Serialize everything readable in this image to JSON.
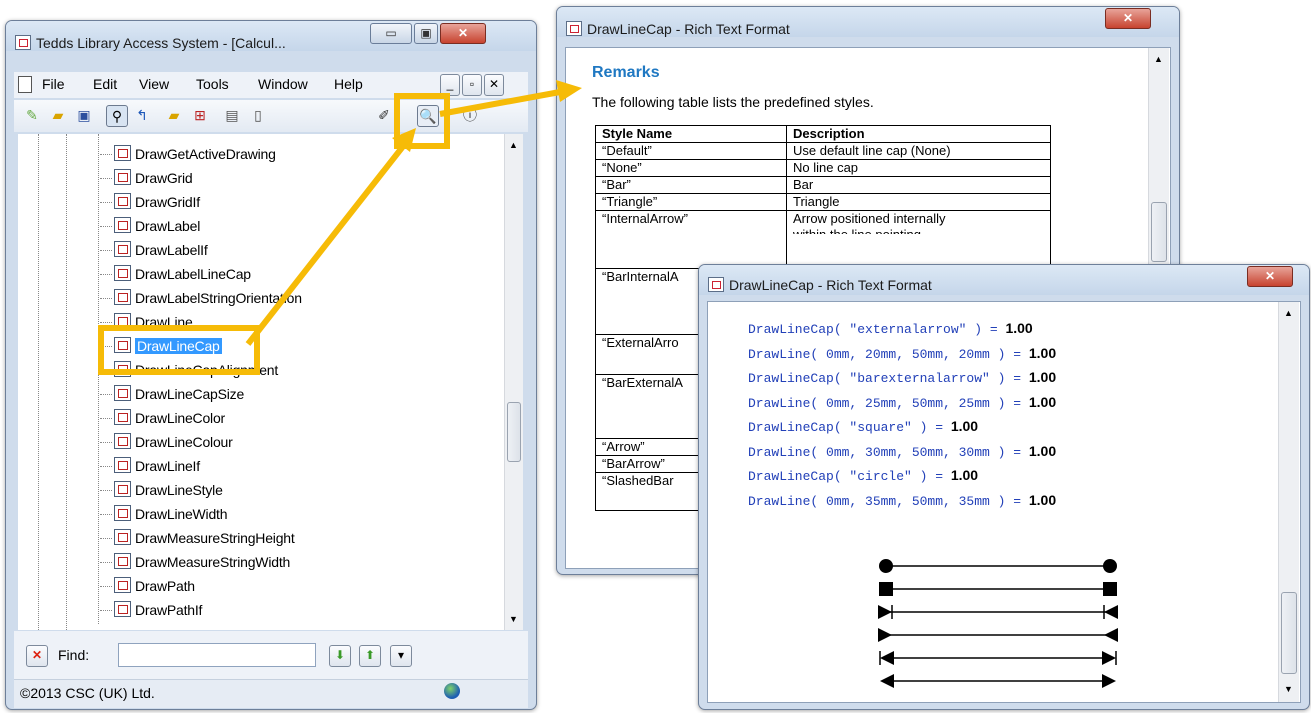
{
  "left_window": {
    "title": "Tedds Library Access System - [Calcul...",
    "menu": [
      "File",
      "Edit",
      "View",
      "Tools",
      "Window",
      "Help"
    ],
    "tree_items": [
      "DrawGetActiveDrawing",
      "DrawGrid",
      "DrawGridIf",
      "DrawLabel",
      "DrawLabelIf",
      "DrawLabelLineCap",
      "DrawLabelStringOrientation",
      "DrawLine",
      "DrawLineCap",
      "DrawLineCapAlignment",
      "DrawLineCapSize",
      "DrawLineColor",
      "DrawLineColour",
      "DrawLineIf",
      "DrawLineStyle",
      "DrawLineWidth",
      "DrawMeasureStringHeight",
      "DrawMeasureStringWidth",
      "DrawPath",
      "DrawPathIf"
    ],
    "selected_item": "DrawLineCap",
    "find_label": "Find:",
    "find_value": "",
    "status": "©2013 CSC (UK) Ltd."
  },
  "rtf_window_1": {
    "title": "DrawLineCap - Rich Text Format",
    "heading": "Remarks",
    "intro": "The following table lists the predefined styles.",
    "table": {
      "headers": [
        "Style Name",
        "Description"
      ],
      "rows": [
        [
          "“Default”",
          "Use default line cap (None)"
        ],
        [
          "“None”",
          "No line cap"
        ],
        [
          "“Bar”",
          "Bar"
        ],
        [
          "“Triangle”",
          "Triangle"
        ],
        [
          "“InternalArrow”",
          "Arrow positioned internally"
        ],
        [
          "“BarInternalA",
          ""
        ],
        [
          "“ExternalArro",
          ""
        ],
        [
          "“BarExternalA",
          ""
        ],
        [
          "“Arrow”",
          ""
        ],
        [
          "“BarArrow”",
          ""
        ],
        [
          "“SlashedBar",
          ""
        ]
      ],
      "partial_line": "within the line pointing"
    }
  },
  "rtf_window_2": {
    "title": "DrawLineCap - Rich Text Format",
    "code_lines": [
      {
        "code": "DrawLineCap( \"externalarrow\" ) = ",
        "result": "1.00"
      },
      {
        "code": "DrawLine( 0mm, 20mm, 50mm, 20mm ) = ",
        "result": "1.00"
      },
      {
        "code": "DrawLineCap( \"barexternalarrow\" ) = ",
        "result": "1.00"
      },
      {
        "code": "DrawLine( 0mm, 25mm, 50mm, 25mm ) = ",
        "result": "1.00"
      },
      {
        "code": "DrawLineCap( \"square\" ) = ",
        "result": "1.00"
      },
      {
        "code": "DrawLine( 0mm, 30mm, 50mm, 30mm ) = ",
        "result": "1.00"
      },
      {
        "code": "DrawLineCap( \"circle\" ) = ",
        "result": "1.00"
      },
      {
        "code": "DrawLine( 0mm, 35mm, 50mm, 35mm ) = ",
        "result": "1.00"
      }
    ],
    "preview_caps": [
      "circle",
      "square",
      "barexternalarrow",
      "externalarrow",
      "barinternalarrow",
      "internalarrow"
    ]
  },
  "colors": {
    "highlight": "#f6bb07",
    "selection": "#3399ff",
    "code": "#2240b8"
  }
}
